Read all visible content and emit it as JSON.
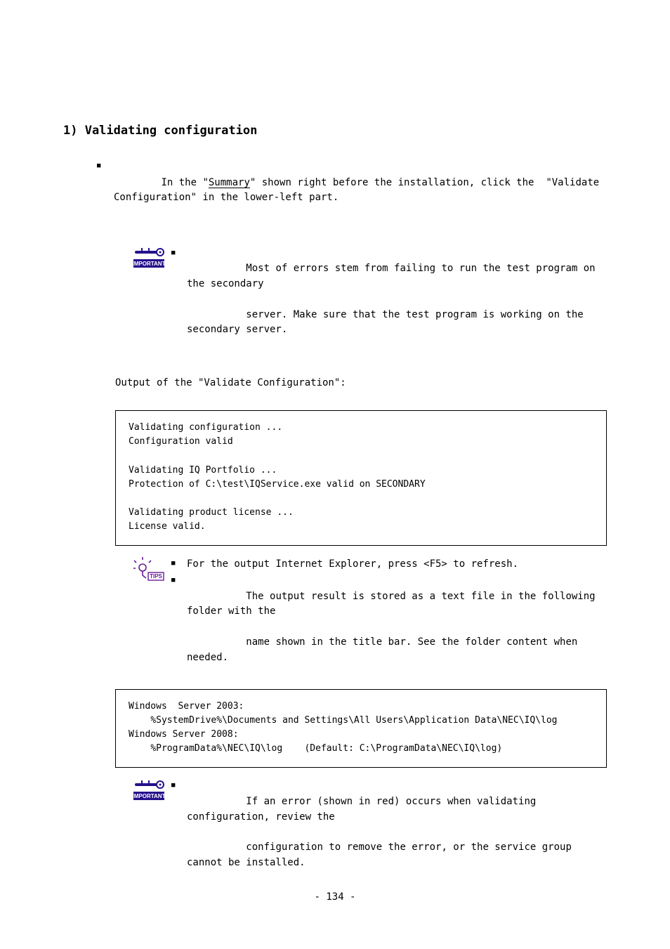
{
  "heading": "1) Validating configuration",
  "intro": {
    "pre": "In the \"",
    "under": "Summary",
    "post": "\" shown right before the installation, click the  \"Validate Configuration\" in the lower-left part."
  },
  "important_label": "IMPORTANT",
  "tips_label": "TIPS",
  "important1_line1": "Most of errors stem from failing to run the test program on the secondary",
  "important1_line2": "server. Make sure that the test program is working on the secondary server.",
  "output_intro": "Output of the \"Validate Configuration\":",
  "codebox1": "Validating configuration ...\nConfiguration valid\n\nValidating IQ Portfolio ...\nProtection of C:\\test\\IQService.exe valid on SECONDARY\n\nValidating product license ...\nLicense valid.",
  "tips1": "For the output Internet Explorer, press <F5> to refresh.",
  "tips2_pre": "The output result is stored as a text file in the following folder with the",
  "tips2_post": "name shown in the title bar. See the folder content when needed.",
  "codebox2": "Windows  Server 2003:\n    %SystemDrive%\\Documents and Settings\\All Users\\Application Data\\NEC\\IQ\\log\nWindows Server 2008:\n    %ProgramData%\\NEC\\IQ\\log    (Default: C:\\ProgramData\\NEC\\IQ\\log)",
  "important2_line1": "If an error (shown in red) occurs when validating configuration, review the",
  "important2_line2": "configuration to remove the error, or the service group cannot be installed.",
  "page_num": "- 134 -"
}
